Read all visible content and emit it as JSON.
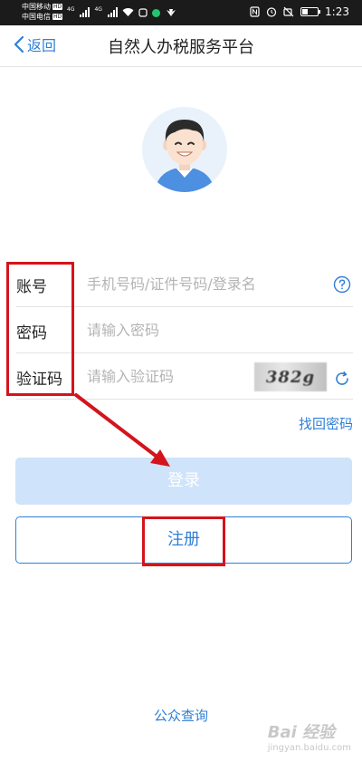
{
  "status_bar": {
    "carrier_1": "中国移动",
    "carrier_2": "中国电信",
    "hd": "HD",
    "net_1": "4G",
    "net_2": "4G",
    "time": "1:23"
  },
  "nav": {
    "back_label": "返回",
    "title": "自然人办税服务平台"
  },
  "form": {
    "account": {
      "label": "账号",
      "placeholder": "手机号码/证件号码/登录名"
    },
    "password": {
      "label": "密码",
      "placeholder": "请输入密码"
    },
    "captcha": {
      "label": "验证码",
      "placeholder": "请输入验证码",
      "image_text": "382g"
    },
    "forgot_label": "找回密码"
  },
  "buttons": {
    "login_label": "登录",
    "register_label": "注册"
  },
  "footer": {
    "public_query_label": "公众查询"
  },
  "watermark": {
    "main": "Bai 经验",
    "sub": "jingyan.baidu.com"
  },
  "colors": {
    "accent": "#2f7fd6",
    "login_disabled": "#cfe3fa",
    "annotation": "#d4141c"
  }
}
